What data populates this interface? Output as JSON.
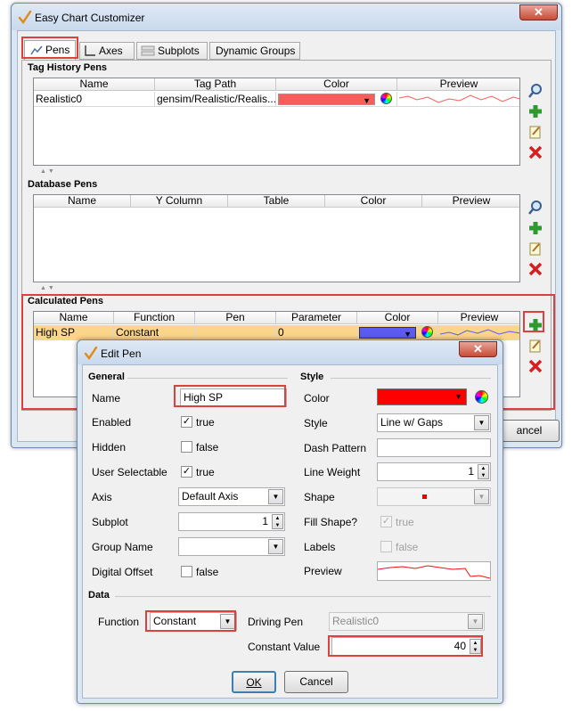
{
  "main_window": {
    "title": "Easy Chart Customizer",
    "close_glyph": "✕",
    "tabs": [
      {
        "label": "Pens",
        "icon": "line-chart-icon"
      },
      {
        "label": "Axes",
        "icon": "axes-icon"
      },
      {
        "label": "Subplots",
        "icon": "subplots-icon"
      },
      {
        "label": "Dynamic Groups",
        "icon": ""
      }
    ],
    "tag_history": {
      "title": "Tag History Pens",
      "columns": [
        "Name",
        "Tag Path",
        "Color",
        "Preview"
      ],
      "rows": [
        {
          "name": "Realistic0",
          "tag_path": "gensim/Realistic/Realis...",
          "color": "#f75d59"
        }
      ]
    },
    "database": {
      "title": "Database Pens",
      "columns": [
        "Name",
        "Y Column",
        "Table",
        "Color",
        "Preview"
      ]
    },
    "calculated": {
      "title": "Calculated Pens",
      "columns": [
        "Name",
        "Function",
        "Pen",
        "Parameter",
        "Color",
        "Preview"
      ],
      "rows": [
        {
          "name": "High SP",
          "function": "Constant",
          "pen": "",
          "parameter": "0",
          "color": "#5b5bf2"
        }
      ]
    },
    "cancel_partial": "ancel"
  },
  "edit_pen": {
    "title": "Edit Pen",
    "close_glyph": "✕",
    "general": {
      "header": "General",
      "name_label": "Name",
      "name_value": "High SP",
      "enabled_label": "Enabled",
      "enabled_text": "true",
      "hidden_label": "Hidden",
      "hidden_text": "false",
      "user_selectable_label": "User Selectable",
      "user_selectable_text": "true",
      "axis_label": "Axis",
      "axis_value": "Default Axis",
      "subplot_label": "Subplot",
      "subplot_value": "1",
      "group_name_label": "Group Name",
      "group_name_value": "",
      "digital_offset_label": "Digital Offset",
      "digital_offset_text": "false"
    },
    "style": {
      "header": "Style",
      "color_label": "Color",
      "color_value": "#ff0000",
      "style_label": "Style",
      "style_value": "Line w/ Gaps",
      "dash_label": "Dash Pattern",
      "dash_value": "",
      "weight_label": "Line Weight",
      "weight_value": "1",
      "shape_label": "Shape",
      "fill_label": "Fill Shape?",
      "fill_text": "true",
      "labels_label": "Labels",
      "labels_text": "false",
      "preview_label": "Preview"
    },
    "data": {
      "header": "Data",
      "function_label": "Function",
      "function_value": "Constant",
      "driving_label": "Driving Pen",
      "driving_value": "Realistic0",
      "constant_label": "Constant Value",
      "constant_value": "40"
    },
    "ok_label": "OK",
    "cancel_label": "Cancel",
    "accent_red": "#d9423e"
  }
}
